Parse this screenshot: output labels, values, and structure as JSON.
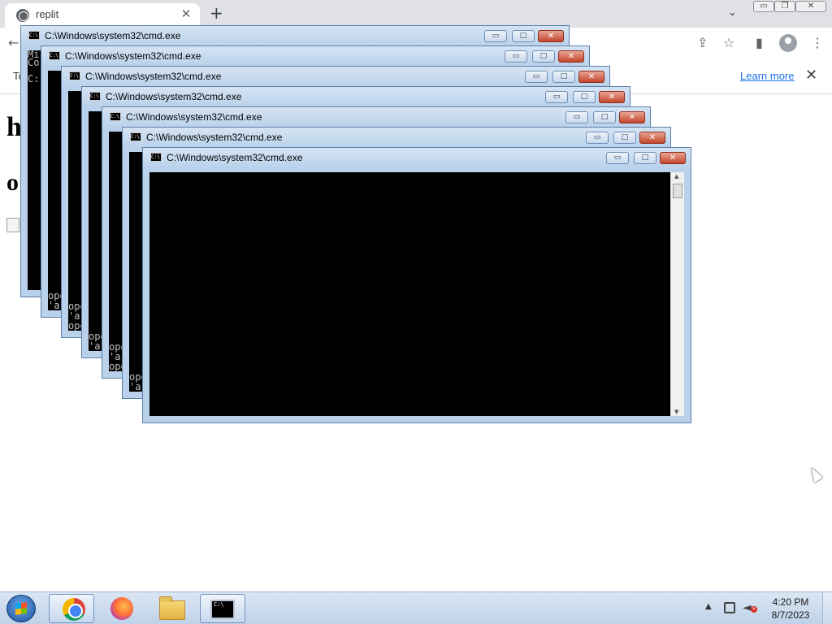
{
  "browser": {
    "tab_title": "replit",
    "tab_close": "✕",
    "new_tab": "+",
    "tab_search": "⌄",
    "window_controls": {
      "minimize": "▭",
      "restore": "❐",
      "close": "✕"
    },
    "toolbar": {
      "back": "←",
      "share": "⇪",
      "bookmark": "☆",
      "sidepanel": "▮",
      "menu": "⋮"
    },
    "infobar": {
      "text": "To",
      "learn_more": "Learn more",
      "close": "✕"
    },
    "page": {
      "heading": "h",
      "subheading": "o"
    }
  },
  "cmd_window": {
    "title": "C:\\Windows\\system32\\cmd.exe",
    "icon_text": "C:\\",
    "min": "▭",
    "max": "□",
    "close": "✕",
    "scroll_up": "▲",
    "scroll_down": "▼",
    "first_window_lines": [
      "Mi",
      "Co",
      "",
      "C:"
    ],
    "lines_a": [
      "operable program or batch file.",
      "'a' is not recognized as an internal or external command,"
    ],
    "lines_b": [
      "operable program or batch file.",
      "'a' is not recognized as an internal or external command,",
      "operable program or batch file."
    ]
  },
  "taskbar": {
    "apps": [
      "chrome-icon",
      "firefox-icon",
      "explorer-icon",
      "cmd-icon"
    ],
    "tray_arrow": "▲",
    "clock_time": "4:20 PM",
    "clock_date": "8/7/2023"
  },
  "colors": {
    "titlebar": "#b9d1ea",
    "close_button": "#c4452c",
    "console_bg": "#000000",
    "console_text": "#c0c0c0",
    "link": "#1a73e8"
  }
}
